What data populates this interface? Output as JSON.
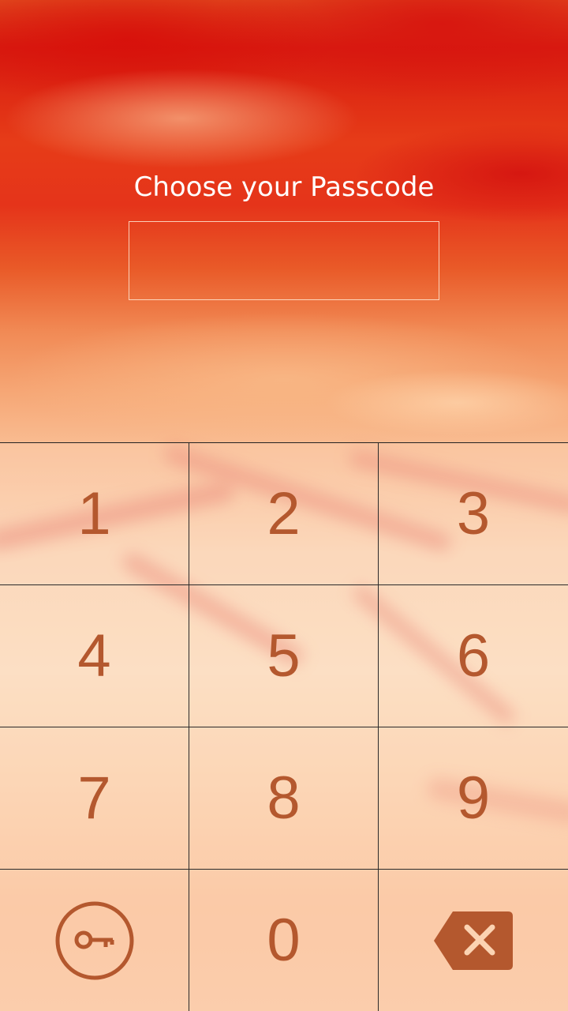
{
  "screen": {
    "title": "Choose your Passcode",
    "passcode_value": ""
  },
  "keypad": {
    "keys": [
      {
        "label": "1"
      },
      {
        "label": "2"
      },
      {
        "label": "3"
      },
      {
        "label": "4"
      },
      {
        "label": "5"
      },
      {
        "label": "6"
      },
      {
        "label": "7"
      },
      {
        "label": "8"
      },
      {
        "label": "9"
      },
      {
        "icon": "key-icon"
      },
      {
        "label": "0"
      },
      {
        "icon": "backspace-icon"
      }
    ]
  },
  "colors": {
    "accent": "#b4582e",
    "title_text": "#ffffff",
    "background_top": "#d81b10",
    "background_bottom": "#fcd0ab"
  }
}
